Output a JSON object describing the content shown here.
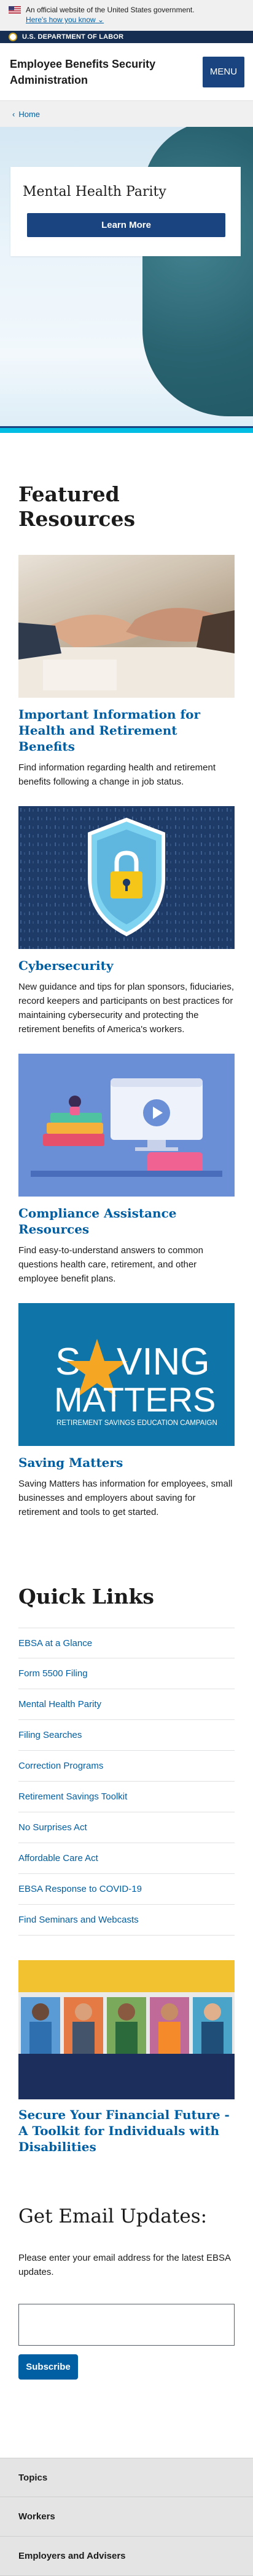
{
  "gov_banner": {
    "text": "An official website of the United States government.",
    "link": "Here's how you know"
  },
  "agency_bar": {
    "label": "U.S. DEPARTMENT OF LABOR"
  },
  "header": {
    "title": "Employee Benefits Security Administration",
    "menu_label": "MENU"
  },
  "breadcrumb": {
    "home": "Home"
  },
  "hero": {
    "title": "Mental Health Parity",
    "button": "Learn More"
  },
  "featured": {
    "heading": "Featured Resources",
    "cards": [
      {
        "title": "Important Information for Health and Retirement Benefits",
        "desc": "Find information regarding health and retirement benefits following a change in job status."
      },
      {
        "title": "Cybersecurity",
        "desc": "New guidance and tips for plan sponsors, fiduciaries, record keepers and participants on best practices for maintaining cybersecurity and protecting the retirement benefits of America's workers."
      },
      {
        "title": "Compliance Assistance Resources",
        "desc": "Find easy-to-understand answers to common questions health care, retirement, and other employee benefit plans."
      },
      {
        "title": "Saving Matters",
        "desc": "Saving Matters has information for employees, small businesses and employers about saving for retirement and tools to get started."
      }
    ],
    "saving_logo": {
      "word1": "S",
      "word1b": "VING",
      "word2": "MATTERS",
      "tagline": "RETIREMENT SAVINGS EDUCATION CAMPAIGN"
    }
  },
  "quick_links": {
    "heading": "Quick Links",
    "items": [
      "EBSA at a Glance",
      "Form 5500 Filing",
      "Mental Health Parity",
      "Filing Searches",
      "Correction Programs",
      "Retirement Savings Toolkit",
      "No Surprises Act",
      "Affordable Care Act",
      "EBSA Response to COVID-19",
      "Find Seminars and Webcasts"
    ]
  },
  "toolkit": {
    "title": "Secure Your Financial Future - A Toolkit for Individuals with Disabilities"
  },
  "email": {
    "heading": "Get Email Updates:",
    "desc": "Please enter your email address for the latest EBSA updates.",
    "input_value": "",
    "button": "Subscribe"
  },
  "footer": {
    "items": [
      "Topics",
      "Workers",
      "Employers and Advisers"
    ]
  },
  "colors": {
    "primary": "#1a4480",
    "link": "#005ea2",
    "accent": "#00bde3",
    "navy": "#162e51"
  }
}
